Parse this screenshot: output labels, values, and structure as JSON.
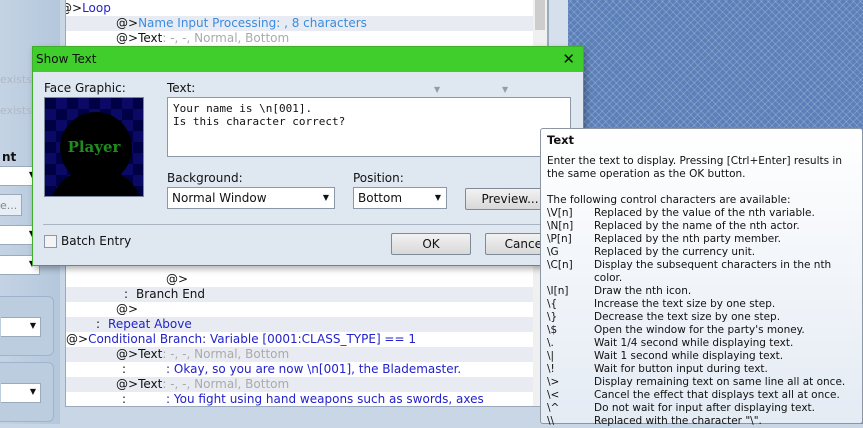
{
  "left_panel": {
    "faded": [
      "exists",
      "exists"
    ],
    "label": "nt",
    "button": "e..."
  },
  "event_list": {
    "rows": [
      {
        "indent": "@>",
        "text": "Loop",
        "style": "blue"
      },
      {
        "indent": "@>",
        "text": "Name Input Processing: , 8 characters",
        "style": "lblue"
      },
      {
        "indent": "@>",
        "text": "Text",
        "suffix": ": -, -, Normal, Bottom",
        "style": "plain"
      },
      {
        "indent": "@>",
        "text": "",
        "style": "plain"
      },
      {
        "indent": ":",
        "text": "Branch End",
        "style": "plain"
      },
      {
        "indent": "@>",
        "text": "",
        "style": "plain"
      },
      {
        "indent": ":",
        "text": "Repeat Above",
        "style": "blue"
      },
      {
        "indent": "@>",
        "text": "Conditional Branch: Variable [0001:CLASS_TYPE] == 1",
        "style": "blue"
      },
      {
        "indent": "@>",
        "text": "Text",
        "suffix": ": -, -, Normal, Bottom",
        "style": "plain"
      },
      {
        "indent": ":",
        "text": ": Okay, so you are now \\n[001], the Blademaster.",
        "style": "navy"
      },
      {
        "indent": "@>",
        "text": "Text",
        "suffix": ": -, -, Normal, Bottom",
        "style": "plain"
      },
      {
        "indent": ":",
        "text": ": You fight using hand weapons such as swords, axes",
        "style": "navy"
      }
    ]
  },
  "dialog": {
    "title": "Show Text",
    "face_label": "Face Graphic:",
    "face_name": "Player",
    "text_label": "Text:",
    "text_value": "Your name is \\n[001].\nIs this character correct?",
    "background_label": "Background:",
    "background_value": "Normal Window",
    "position_label": "Position:",
    "position_value": "Bottom",
    "preview": "Preview...",
    "batch_entry": "Batch Entry",
    "batch_checked": false,
    "ok": "OK",
    "cancel": "Cancel"
  },
  "tooltip": {
    "title": "Text",
    "intro": "Enter the text to display. Pressing [Ctrl+Enter] results in the same operation as the OK button.",
    "list_header": "The following control characters are available:",
    "codes": [
      {
        "k": "\\V[n]",
        "d": "Replaced by the value of the nth variable."
      },
      {
        "k": "\\N[n]",
        "d": "Replaced by the name of the nth actor."
      },
      {
        "k": "\\P[n]",
        "d": "Replaced by the nth party member."
      },
      {
        "k": "\\G",
        "d": "Replaced by the currency unit."
      },
      {
        "k": "\\C[n]",
        "d": "Display the subsequent characters in the nth color."
      },
      {
        "k": "\\I[n]",
        "d": "Draw the nth icon."
      },
      {
        "k": "\\{",
        "d": "Increase the text size by one step."
      },
      {
        "k": "\\}",
        "d": "Decrease the text size by one step."
      },
      {
        "k": "\\$",
        "d": "Open the window for the party's money."
      },
      {
        "k": "\\.",
        "d": "Wait 1/4 second while displaying text."
      },
      {
        "k": "\\|",
        "d": "Wait 1 second while displaying text."
      },
      {
        "k": "\\!",
        "d": "Wait for button input during text."
      },
      {
        "k": "\\>",
        "d": "Display remaining text on same line all at once."
      },
      {
        "k": "\\<",
        "d": "Cancel the effect that displays text all at once."
      },
      {
        "k": "\\^",
        "d": "Do not wait for input after displaying text."
      },
      {
        "k": "\\\\",
        "d": "Replaced with the character \"\\\"."
      }
    ]
  },
  "colors": {
    "title_bar": "#3fce2b",
    "command": "#2222cc",
    "input_cmd": "#3a8be0"
  }
}
